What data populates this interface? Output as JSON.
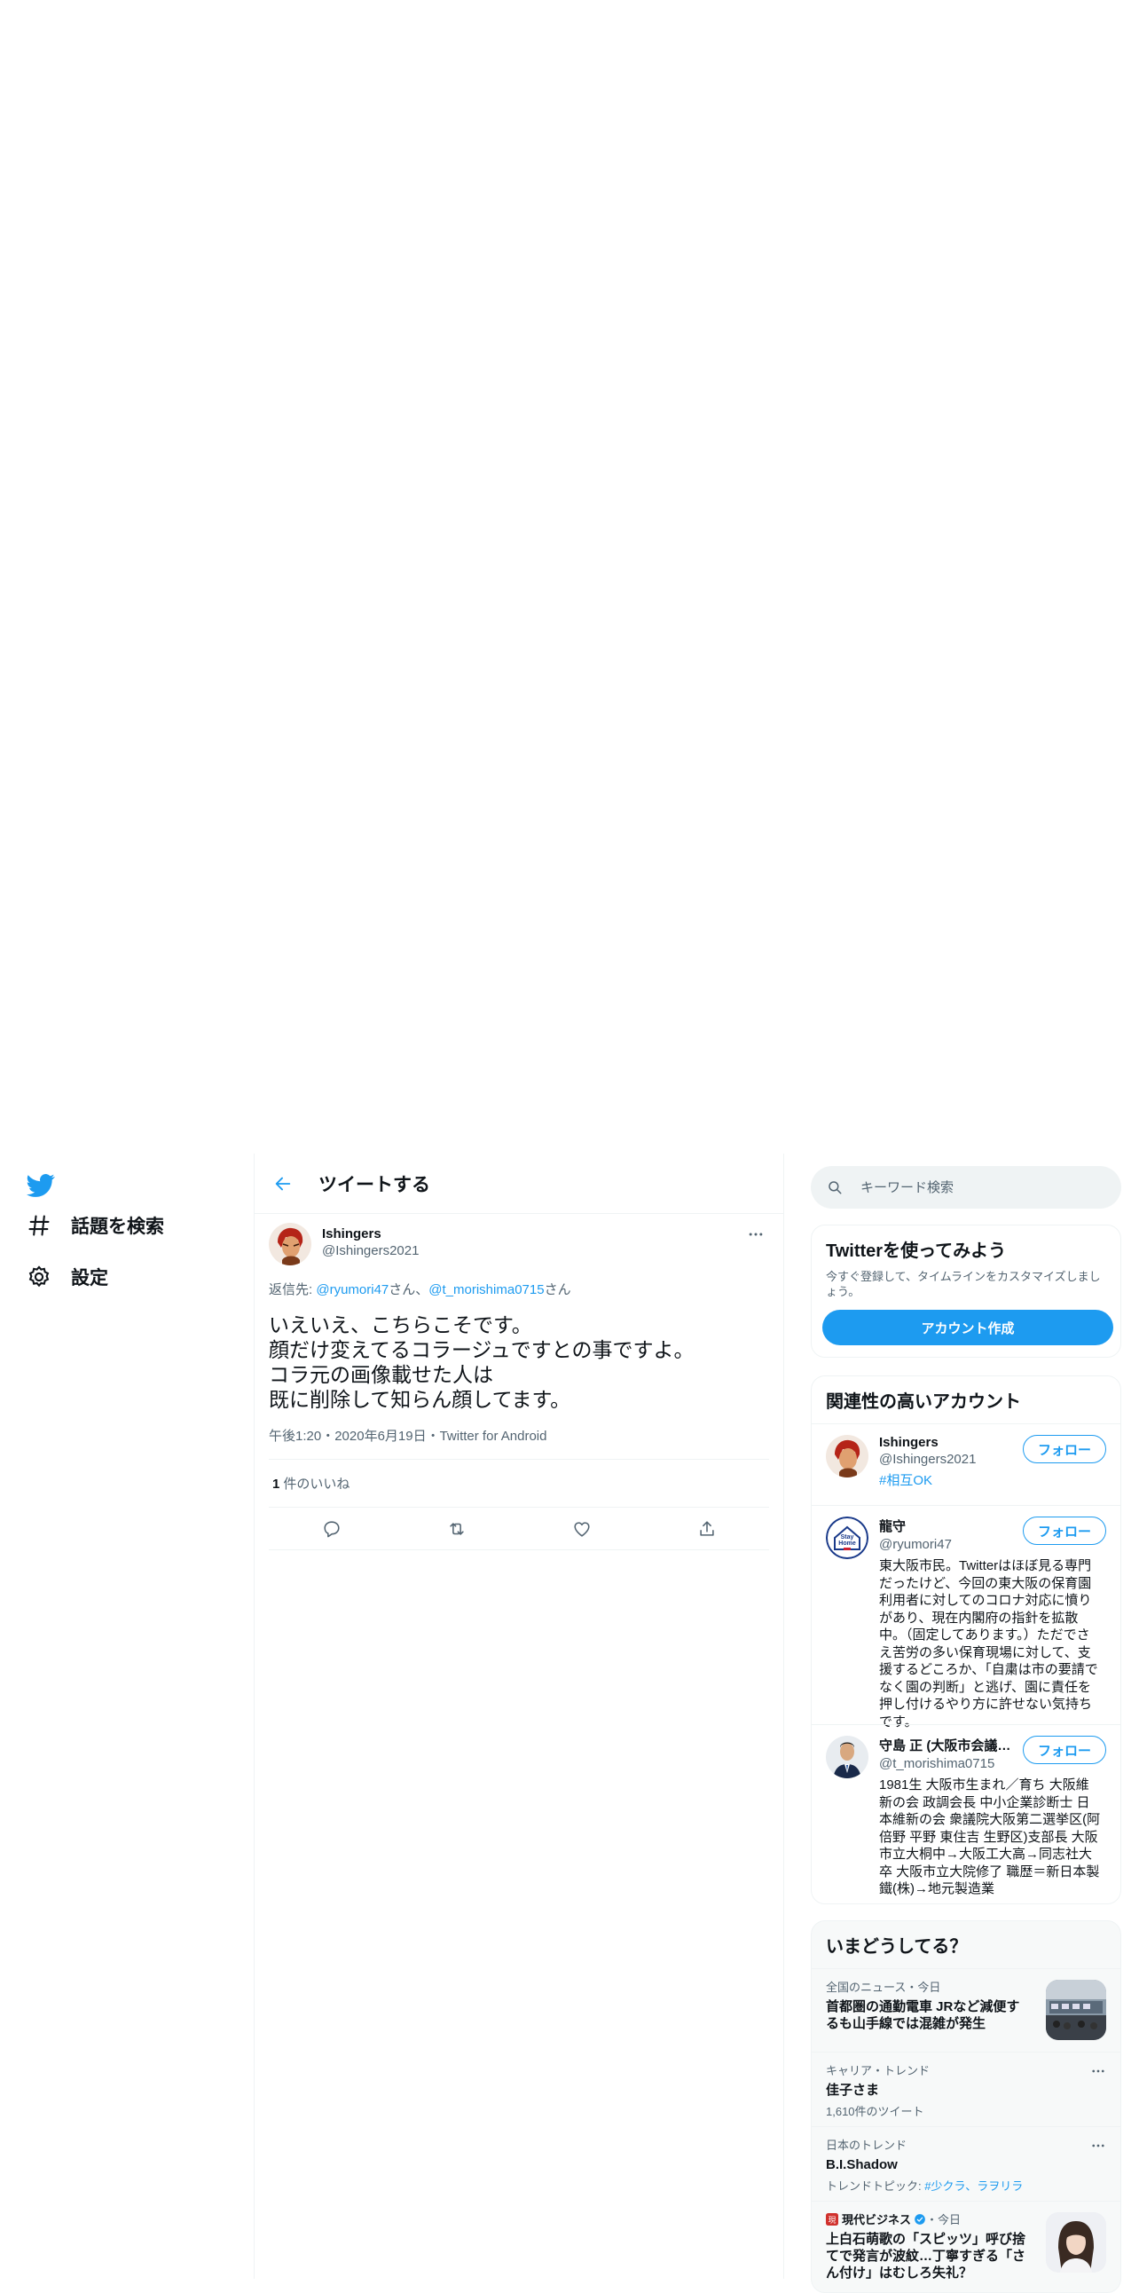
{
  "nav": {
    "explore_label": "話題を検索",
    "settings_label": "設定"
  },
  "header": {
    "title": "ツイートする"
  },
  "tweet": {
    "author_name": "Ishingers",
    "author_handle": "@Ishingers2021",
    "reply_prefix": "返信先: ",
    "reply_mention_1": "@ryumori47",
    "reply_suffix_1": "さん、",
    "reply_mention_2": "@t_morishima0715",
    "reply_suffix_2": "さん",
    "text": "いえいえ、こちらこそです。\n顔だけ変えてるコラージュですとの事ですよ。\nコラ元の画像載せた人は\n既に削除して知らん顔してます。",
    "meta": "午後1:20・2020年6月19日・Twitter for Android",
    "likes_count": "1",
    "likes_label": "件のいいね"
  },
  "search": {
    "placeholder": "キーワード検索"
  },
  "signup": {
    "title": "Twitterを使ってみよう",
    "desc": "今すぐ登録して、タイムラインをカスタマイズしましょう。",
    "button": "アカウント作成"
  },
  "related": {
    "title": "関連性の高いアカウント",
    "follow_label": "フォロー",
    "accounts": [
      {
        "name": "Ishingers",
        "handle": "@Ishingers2021",
        "bio": "#相互OK"
      },
      {
        "name": "龍守",
        "handle": "@ryumori47",
        "bio": "東大阪市民。Twitterはほぼ見る専門だったけど、今回の東大阪の保育園利用者に対してのコロナ対応に憤りがあり、現在内閣府の指針を拡散中。（固定してあります。）ただでさえ苦労の多い保育現場に対して、支援するどころか、「自粛は市の要請でなく園の判断」と逃げ、園に責任を押し付けるやり方に許せない気持ちです。"
      },
      {
        "name": "守島 正 (大阪市会議員)",
        "handle": "@t_morishima0715",
        "bio": "1981生 大阪市生まれ／育ち 大阪維新の会 政調会長 中小企業診断士 日本維新の会 衆議院大阪第二選挙区(阿倍野 平野 東住吉 生野区)支部長 大阪市立大桐中→大阪工大高→同志社大卒 大阪市立大院修了 職歴＝新日本製鐵(株)→地元製造業"
      }
    ]
  },
  "trends": {
    "title": "いまどうしてる？",
    "items": [
      {
        "meta": "全国のニュース・今日",
        "title": "首都圏の通勤電車 JRなど減便するも山手線では混雑が発生"
      },
      {
        "meta": "キャリア・トレンド",
        "title": "佳子さま",
        "sub": "1,610件のツイート"
      },
      {
        "meta": "日本のトレンド",
        "title": "B.I.Shadow",
        "sub_prefix": "トレンドトピック: ",
        "sub_topic": "#少クラ、ラヲリラ"
      },
      {
        "source": "現代ビジネス",
        "meta": "・今日",
        "title": "上白石萌歌の「スピッツ」呼び捨てで発言が波紋…丁寧すぎる「さん付け」はむしろ失礼？"
      }
    ]
  }
}
